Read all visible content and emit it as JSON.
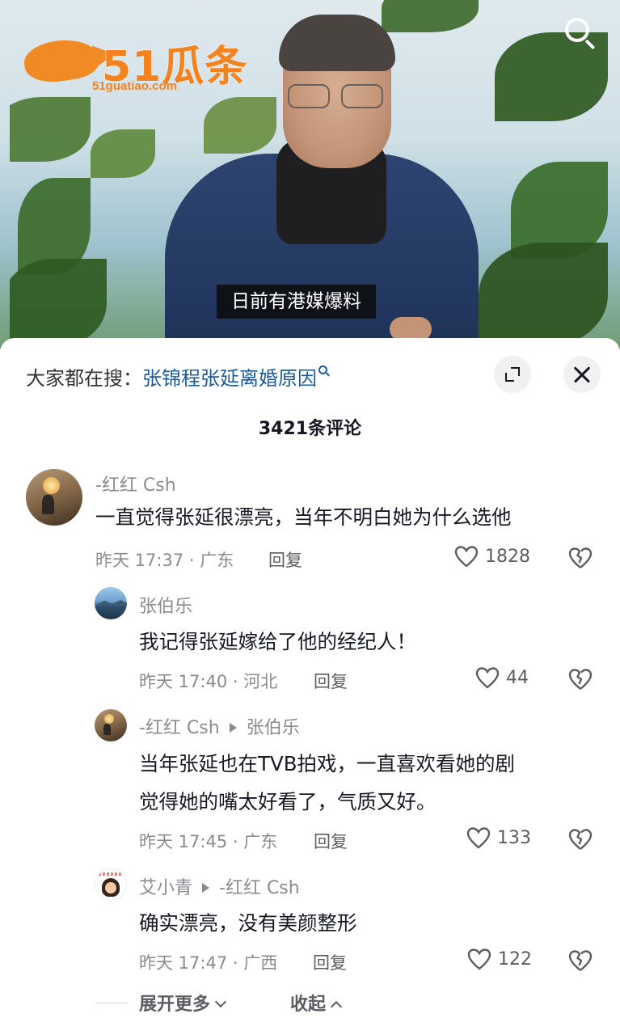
{
  "video": {
    "subtitle": "日前有港媒爆料",
    "watermark": {
      "brand": "51瓜条",
      "url": "51guatiao.com",
      "icon": "fish-logo-icon",
      "color": "#f4821f"
    },
    "search_icon": "search-icon"
  },
  "sheet": {
    "hot_search_prefix": "大家都在搜：",
    "hot_search_term": "张锦程张延离婚原因",
    "expand_icon": "expand-icon",
    "close_icon": "close-icon",
    "comment_count": "3421条评论",
    "link_color": "#1c5a9c"
  },
  "comments": [
    {
      "user": "-红红 Csh",
      "text": "一直觉得张延很漂亮，当年不明白她为什么选他",
      "meta": "昨天 17:37 · 广东",
      "reply": "回复",
      "likes": "1828"
    }
  ],
  "replies": [
    {
      "user": "张伯乐",
      "text": "我记得张延嫁给了他的经纪人！",
      "meta": "昨天 17:40 · 河北",
      "reply": "回复",
      "likes": "44"
    },
    {
      "user": "-红红 Csh",
      "reply_to": "张伯乐",
      "text_lines": [
        "当年张延也在TVB拍戏，一直喜欢看她的剧",
        "觉得她的嘴太好看了，气质又好。"
      ],
      "meta": "昨天 17:45 · 广东",
      "reply": "回复",
      "likes": "133"
    },
    {
      "user": "艾小青",
      "reply_to": "-红红 Csh",
      "text": "确实漂亮，没有美颜整形",
      "meta": "昨天 17:47 · 广西",
      "reply": "回复",
      "likes": "122"
    }
  ],
  "footer": {
    "expand_more": "展开更多",
    "collapse": "收起"
  }
}
